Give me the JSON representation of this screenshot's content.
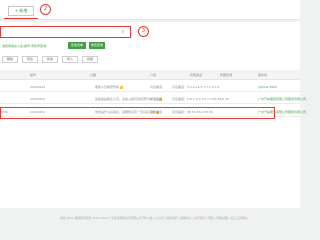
{
  "toolbar": {
    "add_label": "+ 新增"
  },
  "callouts": {
    "two": "2",
    "three": "3"
  },
  "filter": {
    "label": "消费者联系人名/编号/手机号查询：",
    "chips": [
      "查询清单",
      "重置查询"
    ]
  },
  "actions": [
    "删除",
    "导出",
    "修改",
    "导入",
    "批量"
  ],
  "table": {
    "headers": [
      "编号",
      "日期",
      "介绍",
      "所属渠道",
      "所属区域",
      "服务商"
    ],
    "rows": [
      {
        "id": "",
        "date": "20230101",
        "title": "服务人员电话号码",
        "channel": "平台渠道",
        "region": "平台渠道：5.3.4.12,5.7.7,7.0.7.6",
        "vendor": "gifhost.4560"
      },
      {
        "id": "",
        "date": "20230201",
        "title": "这是我是联系人员，请加入我们的优惠汽车门口",
        "channel": "平台渠道",
        "region": "平台渠道：5.6.7.5.7.3.5.7,4.55.58,6.35",
        "vendor": "广州汽车服务有限公司服务有限公司"
      },
      {
        "id": "8780",
        "date": "20230201",
        "title": "你这是什么好消息，说明你没有一天好好活着",
        "channel": "平台渠道",
        "region": "平台渠道：58.51,56.0.58.56",
        "vendor": "广州汽车服务有限公司服务有限公司"
      }
    ]
  },
  "footer": "版权 2020 保留所有权利 2015-2020 广东某某网络技术有限公司 粤ICP备 | 公众号 | 联系我们 | 帮助中心 | 关于我们 | 隐私 | 网站地图 | 加入工商网站"
}
